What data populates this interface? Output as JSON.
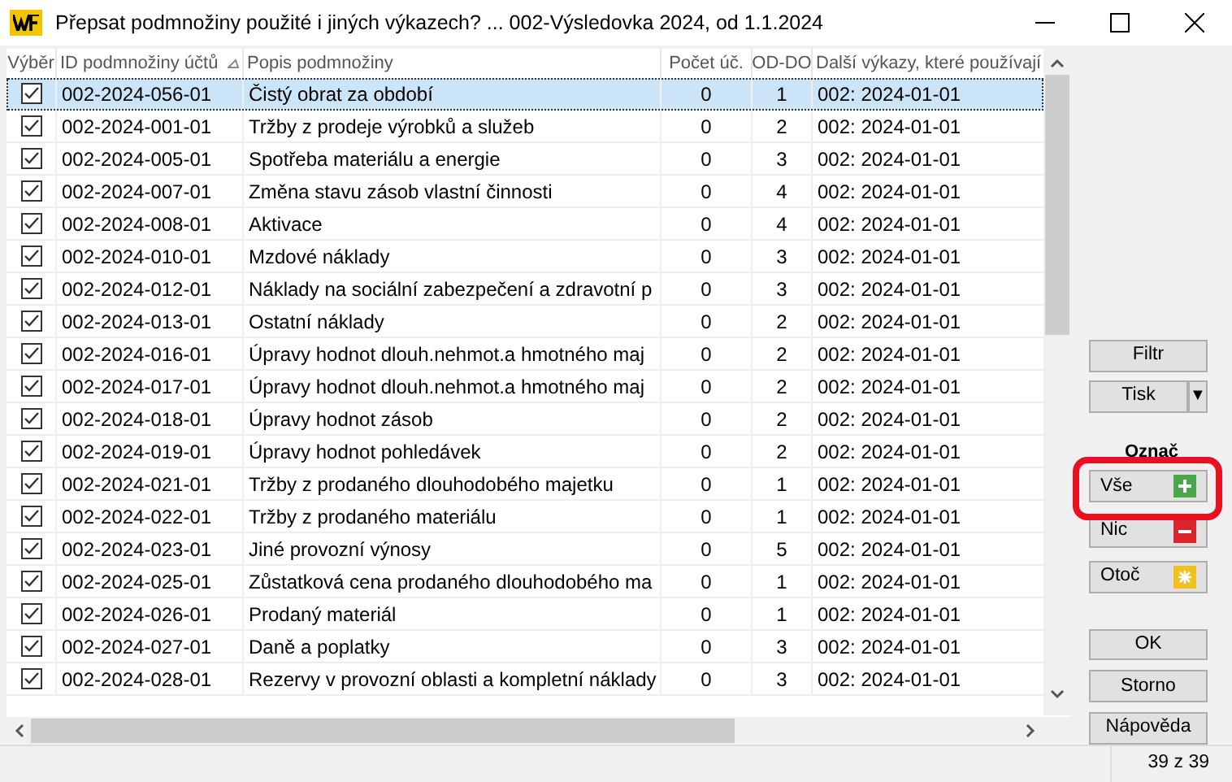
{
  "window": {
    "title": "Přepsat podmnožiny použité i jiných výkazech? ... 002-Výsledovka 2024, od 1.1.2024"
  },
  "table": {
    "columns": [
      "Výběr",
      "ID podmnožiny účtů",
      "Popis podmnožiny",
      "Počet úč.",
      "OD-DO",
      "Další výkazy, které používají"
    ],
    "rows": [
      {
        "checked": true,
        "selected": true,
        "id": "002-2024-056-01",
        "description": "Čistý obrat za období",
        "count": "0",
        "od_do": "1",
        "other": "002: 2024-01-01"
      },
      {
        "checked": true,
        "selected": false,
        "id": "002-2024-001-01",
        "description": "Tržby z prodeje výrobků a služeb",
        "count": "0",
        "od_do": "2",
        "other": "002: 2024-01-01"
      },
      {
        "checked": true,
        "selected": false,
        "id": "002-2024-005-01",
        "description": "Spotřeba materiálu a energie",
        "count": "0",
        "od_do": "3",
        "other": "002: 2024-01-01"
      },
      {
        "checked": true,
        "selected": false,
        "id": "002-2024-007-01",
        "description": "Změna stavu zásob vlastní činnosti",
        "count": "0",
        "od_do": "4",
        "other": "002: 2024-01-01"
      },
      {
        "checked": true,
        "selected": false,
        "id": "002-2024-008-01",
        "description": "Aktivace",
        "count": "0",
        "od_do": "4",
        "other": "002: 2024-01-01"
      },
      {
        "checked": true,
        "selected": false,
        "id": "002-2024-010-01",
        "description": "Mzdové náklady",
        "count": "0",
        "od_do": "3",
        "other": "002: 2024-01-01"
      },
      {
        "checked": true,
        "selected": false,
        "id": "002-2024-012-01",
        "description": "Náklady na sociální zabezpečení a zdravotní p",
        "count": "0",
        "od_do": "3",
        "other": "002: 2024-01-01"
      },
      {
        "checked": true,
        "selected": false,
        "id": "002-2024-013-01",
        "description": "Ostatní náklady",
        "count": "0",
        "od_do": "2",
        "other": "002: 2024-01-01"
      },
      {
        "checked": true,
        "selected": false,
        "id": "002-2024-016-01",
        "description": "Úpravy hodnot dlouh.nehmot.a hmotného maj",
        "count": "0",
        "od_do": "2",
        "other": "002: 2024-01-01"
      },
      {
        "checked": true,
        "selected": false,
        "id": "002-2024-017-01",
        "description": "Úpravy hodnot dlouh.nehmot.a hmotného maj",
        "count": "0",
        "od_do": "2",
        "other": "002: 2024-01-01"
      },
      {
        "checked": true,
        "selected": false,
        "id": "002-2024-018-01",
        "description": "Úpravy hodnot zásob",
        "count": "0",
        "od_do": "2",
        "other": "002: 2024-01-01"
      },
      {
        "checked": true,
        "selected": false,
        "id": "002-2024-019-01",
        "description": "Úpravy hodnot pohledávek",
        "count": "0",
        "od_do": "2",
        "other": "002: 2024-01-01"
      },
      {
        "checked": true,
        "selected": false,
        "id": "002-2024-021-01",
        "description": "Tržby z prodaného dlouhodobého majetku",
        "count": "0",
        "od_do": "1",
        "other": "002: 2024-01-01"
      },
      {
        "checked": true,
        "selected": false,
        "id": "002-2024-022-01",
        "description": "Tržby z prodaného materiálu",
        "count": "0",
        "od_do": "1",
        "other": "002: 2024-01-01"
      },
      {
        "checked": true,
        "selected": false,
        "id": "002-2024-023-01",
        "description": "Jiné provozní výnosy",
        "count": "0",
        "od_do": "5",
        "other": "002: 2024-01-01"
      },
      {
        "checked": true,
        "selected": false,
        "id": "002-2024-025-01",
        "description": "Zůstatková cena prodaného dlouhodobého ma",
        "count": "0",
        "od_do": "1",
        "other": "002: 2024-01-01"
      },
      {
        "checked": true,
        "selected": false,
        "id": "002-2024-026-01",
        "description": "Prodaný materiál",
        "count": "0",
        "od_do": "1",
        "other": "002: 2024-01-01"
      },
      {
        "checked": true,
        "selected": false,
        "id": "002-2024-027-01",
        "description": "Daně a poplatky",
        "count": "0",
        "od_do": "3",
        "other": "002: 2024-01-01"
      },
      {
        "checked": true,
        "selected": false,
        "id": "002-2024-028-01",
        "description": "Rezervy v provozní oblasti a kompletní náklady",
        "count": "0",
        "od_do": "3",
        "other": "002: 2024-01-01"
      }
    ]
  },
  "side_panel": {
    "filter_button": "Filtr",
    "print_button": "Tisk",
    "print_dropdown": "▼",
    "mark_label": "Označ",
    "mark_buttons": [
      {
        "label": "Vše",
        "kind": "all",
        "highlighted": true
      },
      {
        "label": "Nic",
        "kind": "none",
        "highlighted": false
      },
      {
        "label": "Otoč",
        "kind": "invert",
        "highlighted": false
      }
    ],
    "dialog_buttons": [
      "OK",
      "Storno",
      "Nápověda"
    ]
  },
  "status_bar": {
    "count": "39 z 39"
  }
}
